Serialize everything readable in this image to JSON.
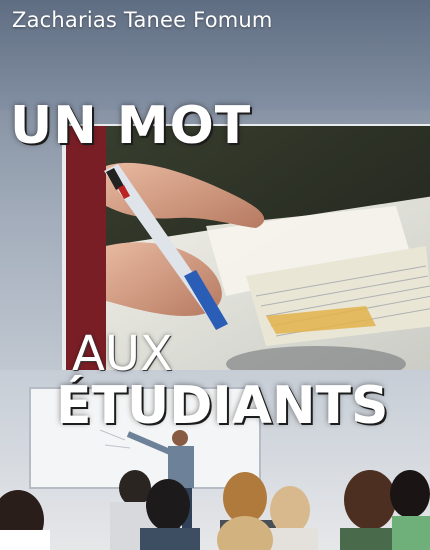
{
  "cover": {
    "author": "Zacharias Tanee Fomum",
    "title_line_1": "UN MOT",
    "title_line_2": "AUX",
    "title_line_3": "ÉTUDIANTS"
  },
  "colors": {
    "title_text": "#ffffff",
    "frame_border": "#e8ecef",
    "background_top": "#6d7a8e",
    "background_bottom": "#d5d8dc"
  },
  "images": {
    "top_photo": "hand-writing-in-notebook-photo",
    "bottom_photo": "classroom-lecture-photo"
  }
}
